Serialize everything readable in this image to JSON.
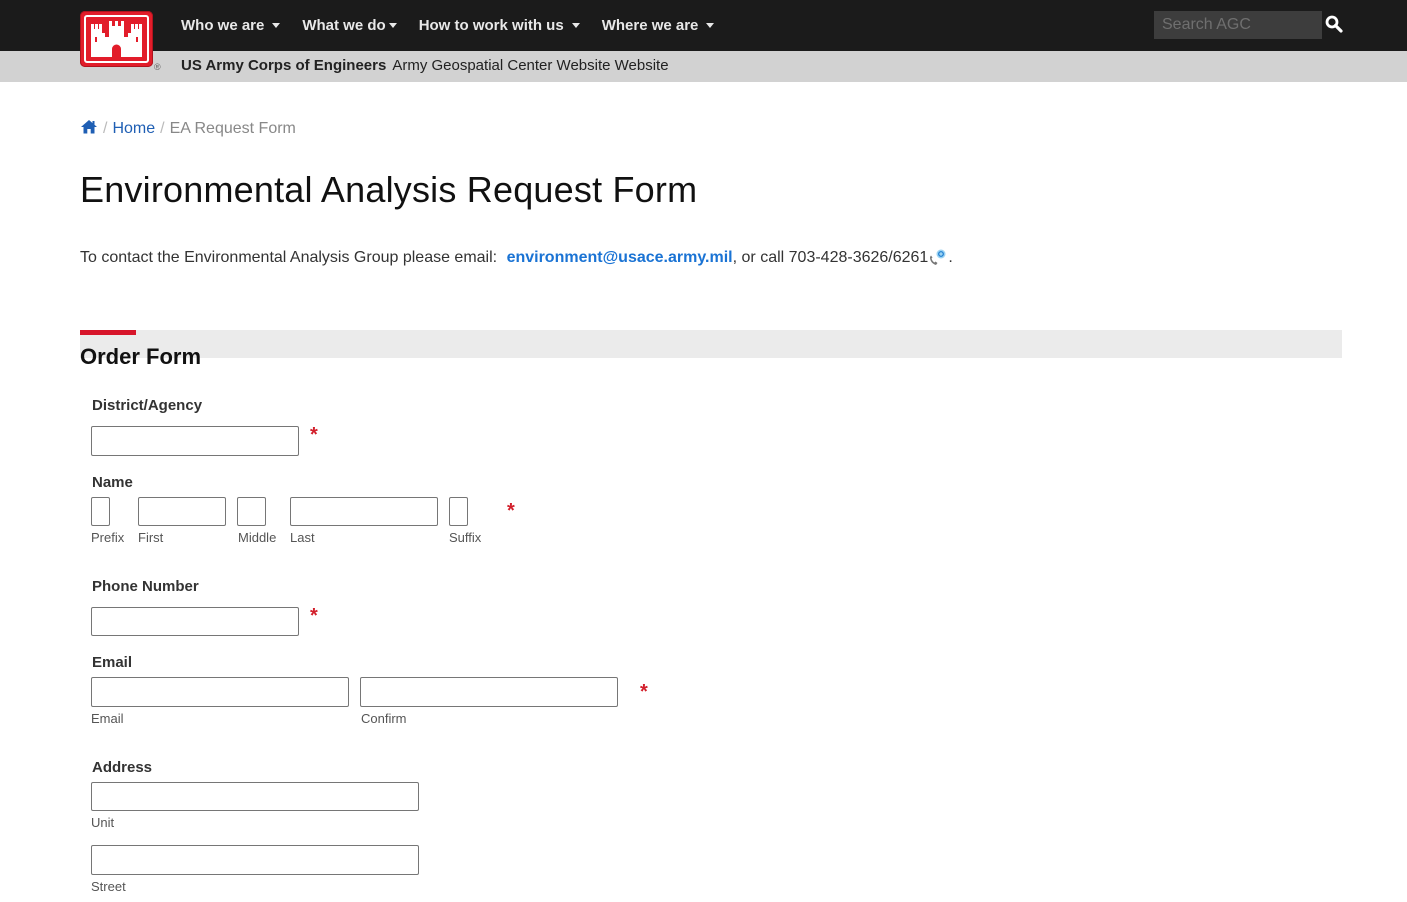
{
  "header": {
    "nav": [
      {
        "label": "Who we are"
      },
      {
        "label": "What we do"
      },
      {
        "label": "How to work with us"
      },
      {
        "label": "Where we are"
      }
    ],
    "search_placeholder": "Search AGC",
    "org_name": "US Army Corps of Engineers",
    "site_name": "Army Geospatial Center Website Website",
    "registered_mark": "®"
  },
  "breadcrumb": {
    "separator": "/",
    "home_label": "Home",
    "current": "EA Request Form"
  },
  "page": {
    "title": "Environmental Analysis Request Form",
    "contact_prefix": "To contact the Environmental Analysis Group please email:",
    "contact_email": "environment@usace.army.mil",
    "contact_middle": ", or call 703-428-3626/6261",
    "contact_suffix": "."
  },
  "form": {
    "section_title": "Order Form",
    "required_marker": "*",
    "district": {
      "label": "District/Agency",
      "value": ""
    },
    "name": {
      "label": "Name",
      "parts": [
        {
          "sub": "Prefix",
          "value": ""
        },
        {
          "sub": "First",
          "value": ""
        },
        {
          "sub": "Middle",
          "value": ""
        },
        {
          "sub": "Last",
          "value": ""
        },
        {
          "sub": "Suffix",
          "value": ""
        }
      ]
    },
    "phone": {
      "label": "Phone Number",
      "value": ""
    },
    "email": {
      "label": "Email",
      "email_sub": "Email",
      "confirm_sub": "Confirm",
      "value": "",
      "confirm_value": ""
    },
    "address": {
      "label": "Address",
      "unit_sub": "Unit",
      "street_sub": "Street",
      "unit_value": "",
      "street_value": ""
    }
  },
  "colors": {
    "brand_red": "#e21d2a",
    "link_blue": "#1a73d4",
    "nav_bg": "#1b1b1b",
    "required_red": "#d21f2b"
  }
}
